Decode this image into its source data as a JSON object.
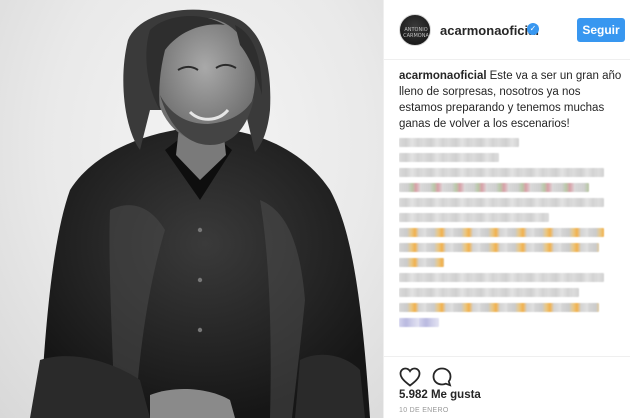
{
  "post": {
    "username": "acarmonaoficial",
    "verified": true,
    "follow_label": "Seguir",
    "avatar_text": "ANTONIO CARMONA",
    "caption": "Este va a ser un gran año lleno de sorpresas, nosotros ya nos estamos preparando y tenemos muchas ganas de volver a los escenarios!",
    "likes": "5.982 Me gusta",
    "date": "10 DE ENERO"
  },
  "colors": {
    "accent": "#3897f0",
    "text": "#262626",
    "muted": "#999999",
    "border": "#efefef"
  },
  "icons": {
    "like": "heart-icon",
    "comment": "comment-icon",
    "verified": "verified-badge-icon"
  }
}
